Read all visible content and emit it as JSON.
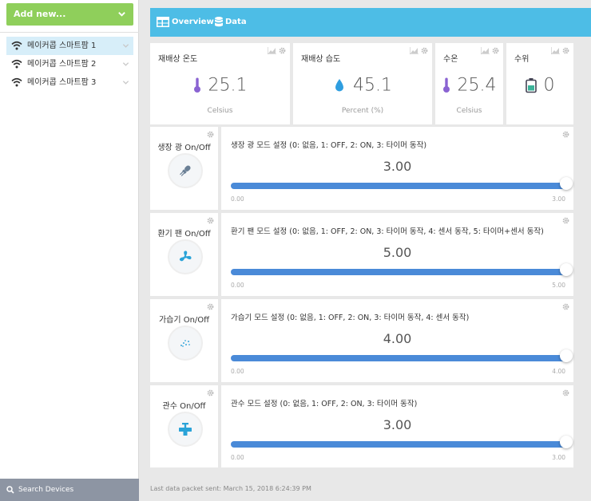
{
  "sidebar": {
    "add_new_label": "Add new...",
    "devices": [
      {
        "name": "메이커콥 스마트팜 1",
        "active": true
      },
      {
        "name": "메이커콥 스마트팜 2",
        "active": false
      },
      {
        "name": "메이커콥 스마트팜 3",
        "active": false
      }
    ],
    "search_label": "Search Devices"
  },
  "header": {
    "tabs": [
      {
        "label": "Overview",
        "icon": "grid-icon"
      },
      {
        "label": "Data",
        "icon": "database-icon"
      }
    ]
  },
  "sensors": [
    {
      "title": "재배상 온도",
      "value": "25.1",
      "unit": "Celsius",
      "icon": "thermometer-icon"
    },
    {
      "title": "재배상 습도",
      "value": "45.1",
      "unit": "Percent (%)",
      "icon": "water-drop-icon"
    },
    {
      "title": "수온",
      "value": "25.4",
      "unit": "Celsius",
      "icon": "thermometer-icon"
    },
    {
      "title": "수위",
      "value": "0",
      "unit": "",
      "icon": "battery-icon"
    }
  ],
  "controls": [
    {
      "switch_title": "생장 광 On/Off",
      "switch_icon": "light-bulb-icon",
      "slider_title": "생장 광 모드 설정 (0: 없음, 1: OFF, 2: ON, 3: 타이머 동작)",
      "value": "3.00",
      "min": "0.00",
      "max": "3.00",
      "level": 1.0
    },
    {
      "switch_title": "환기 팬 On/Off",
      "switch_icon": "fan-icon",
      "slider_title": "환기 팬 모드 설정 (0: 없음, 1: OFF, 2: ON, 3: 타이머 동작, 4: 센서 동작, 5: 타이머+센서 동작)",
      "value": "5.00",
      "min": "0.00",
      "max": "5.00",
      "level": 1.0
    },
    {
      "switch_title": "가습기 On/Off",
      "switch_icon": "mist-icon",
      "slider_title": "가습기 모드 설정 (0: 없음, 1: OFF, 2: ON, 3: 타이머 동작, 4: 센서 동작)",
      "value": "4.00",
      "min": "0.00",
      "max": "4.00",
      "level": 1.0
    },
    {
      "switch_title": "관수 On/Off",
      "switch_icon": "faucet-icon",
      "slider_title": "관수 모드 설정 (0: 없음, 1: OFF, 2: ON, 3: 타이머 동작)",
      "value": "3.00",
      "min": "0.00",
      "max": "3.00",
      "level": 1.0
    }
  ],
  "footer": {
    "last_packet": "Last data packet sent: March 15, 2018 6:24:39 PM"
  },
  "colors": {
    "accent": "#4dbde6",
    "add_button": "#8fcf5b",
    "slider": "#4a8ad8",
    "active_device": "#d7eef9"
  }
}
